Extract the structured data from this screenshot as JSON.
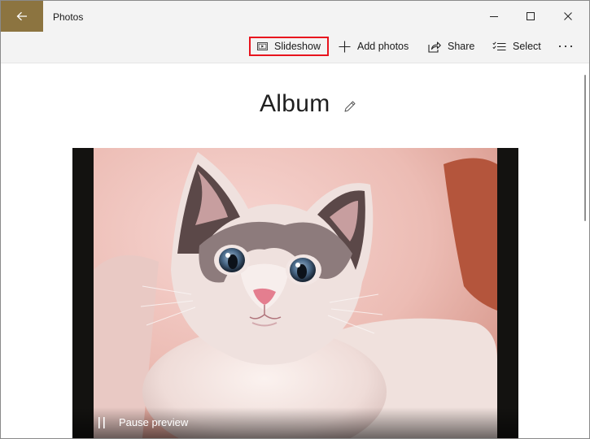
{
  "titlebar": {
    "back_icon": "arrow-left-icon",
    "app_title": "Photos",
    "minimize_icon": "minimize-icon",
    "maximize_icon": "maximize-icon",
    "close_icon": "close-icon",
    "accent_color": "#8c7440"
  },
  "commandbar": {
    "slideshow": {
      "label": "Slideshow",
      "icon": "slideshow-icon",
      "highlighted": true
    },
    "add_photos": {
      "label": "Add photos",
      "icon": "plus-icon"
    },
    "share": {
      "label": "Share",
      "icon": "share-icon"
    },
    "select": {
      "label": "Select",
      "icon": "select-checklist-icon"
    },
    "more": {
      "label": "···",
      "icon": "more-icon"
    }
  },
  "album": {
    "title": "Album",
    "edit_icon": "pencil-icon"
  },
  "preview": {
    "pause_label": "Pause preview",
    "pause_icon": "pause-icon",
    "image_subject": "cat photo"
  },
  "colors": {
    "highlight_border": "#e8141e"
  }
}
